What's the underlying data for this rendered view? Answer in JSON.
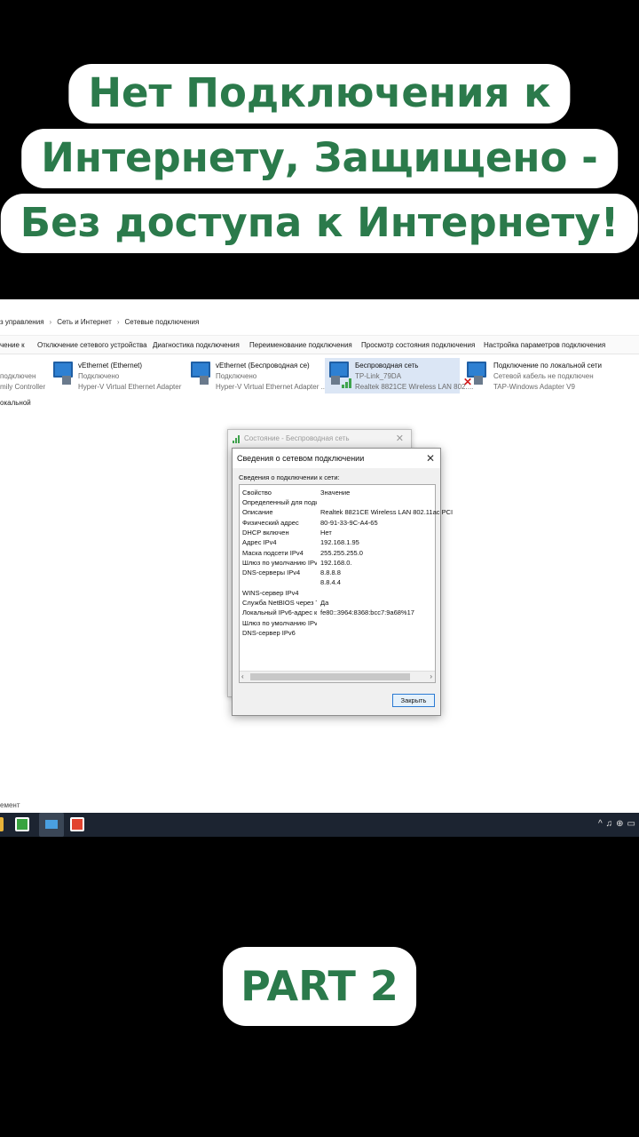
{
  "caption": {
    "line1": "Нет Подключения к",
    "line2": "Интернету, Защищено -",
    "line3": "Без доступа к Интернету!",
    "part": "PART 2"
  },
  "breadcrumb": [
    "з управления",
    "Сеть и Интернет",
    "Сетевые подключения"
  ],
  "toolbar": [
    "чение к",
    "Отключение сетевого устройства",
    "Диагностика подключения",
    "Переименование подключения",
    "Просмотр состояния подключения",
    "Настройка параметров подключения"
  ],
  "left_fragments": [
    "подключен",
    "mily Controller",
    "окальной"
  ],
  "adapters": [
    {
      "name": "vEthernet (Ethernet)",
      "status": "Подключено",
      "device": "Hyper-V Virtual Ethernet Adapter"
    },
    {
      "name": "vEthernet (Беспроводная се)",
      "status": "Подключено",
      "device": "Hyper-V Virtual Ethernet Adapter ..."
    },
    {
      "name": "Беспроводная сеть",
      "status": "TP-Link_79DA",
      "device": "Realtek 8821CE Wireless LAN 802...."
    },
    {
      "name": "Подключение по локальной сети",
      "status": "Сетевой кабель не подключен",
      "device": "TAP-Windows Adapter V9"
    }
  ],
  "status_bar": "емент",
  "back_dialog": {
    "title": "Состояние - Беспроводная сеть"
  },
  "dialog": {
    "title": "Сведения о сетевом подключении",
    "subtitle": "Сведения о подключении к сети:",
    "header_prop": "Свойство",
    "header_val": "Значение",
    "rows": [
      {
        "k": "Определенный для подк...",
        "v": ""
      },
      {
        "k": "Описание",
        "v": "Realtek 8821CE Wireless LAN 802.11ac PCI"
      },
      {
        "k": "Физический адрес",
        "v": "80-91-33-9C-A4-65"
      },
      {
        "k": "DHCP включен",
        "v": "Нет"
      },
      {
        "k": "Адрес IPv4",
        "v": "192.168.1.95"
      },
      {
        "k": "Маска подсети IPv4",
        "v": "255.255.255.0"
      },
      {
        "k": "Шлюз по умолчанию IPv4",
        "v": "192.168.0."
      },
      {
        "k": "DNS-серверы IPv4",
        "v": "8.8.8.8"
      },
      {
        "k": "",
        "v": "8.8.4.4"
      },
      {
        "k": "WINS-сервер IPv4",
        "v": ""
      },
      {
        "k": "Служба NetBIOS через Т...",
        "v": "Да"
      },
      {
        "k": "Локальный IPv6-адрес ка...",
        "v": "fe80::3964:8368:bcc7:9a68%17"
      },
      {
        "k": "Шлюз по умолчанию IPv6",
        "v": ""
      },
      {
        "k": "DNS-сервер IPv6",
        "v": ""
      }
    ],
    "close_label": "Закрыть"
  },
  "colors": {
    "caption_green": "#2b7a4b",
    "taskbar": "#1c2431",
    "selection": "#dbe6f5"
  }
}
